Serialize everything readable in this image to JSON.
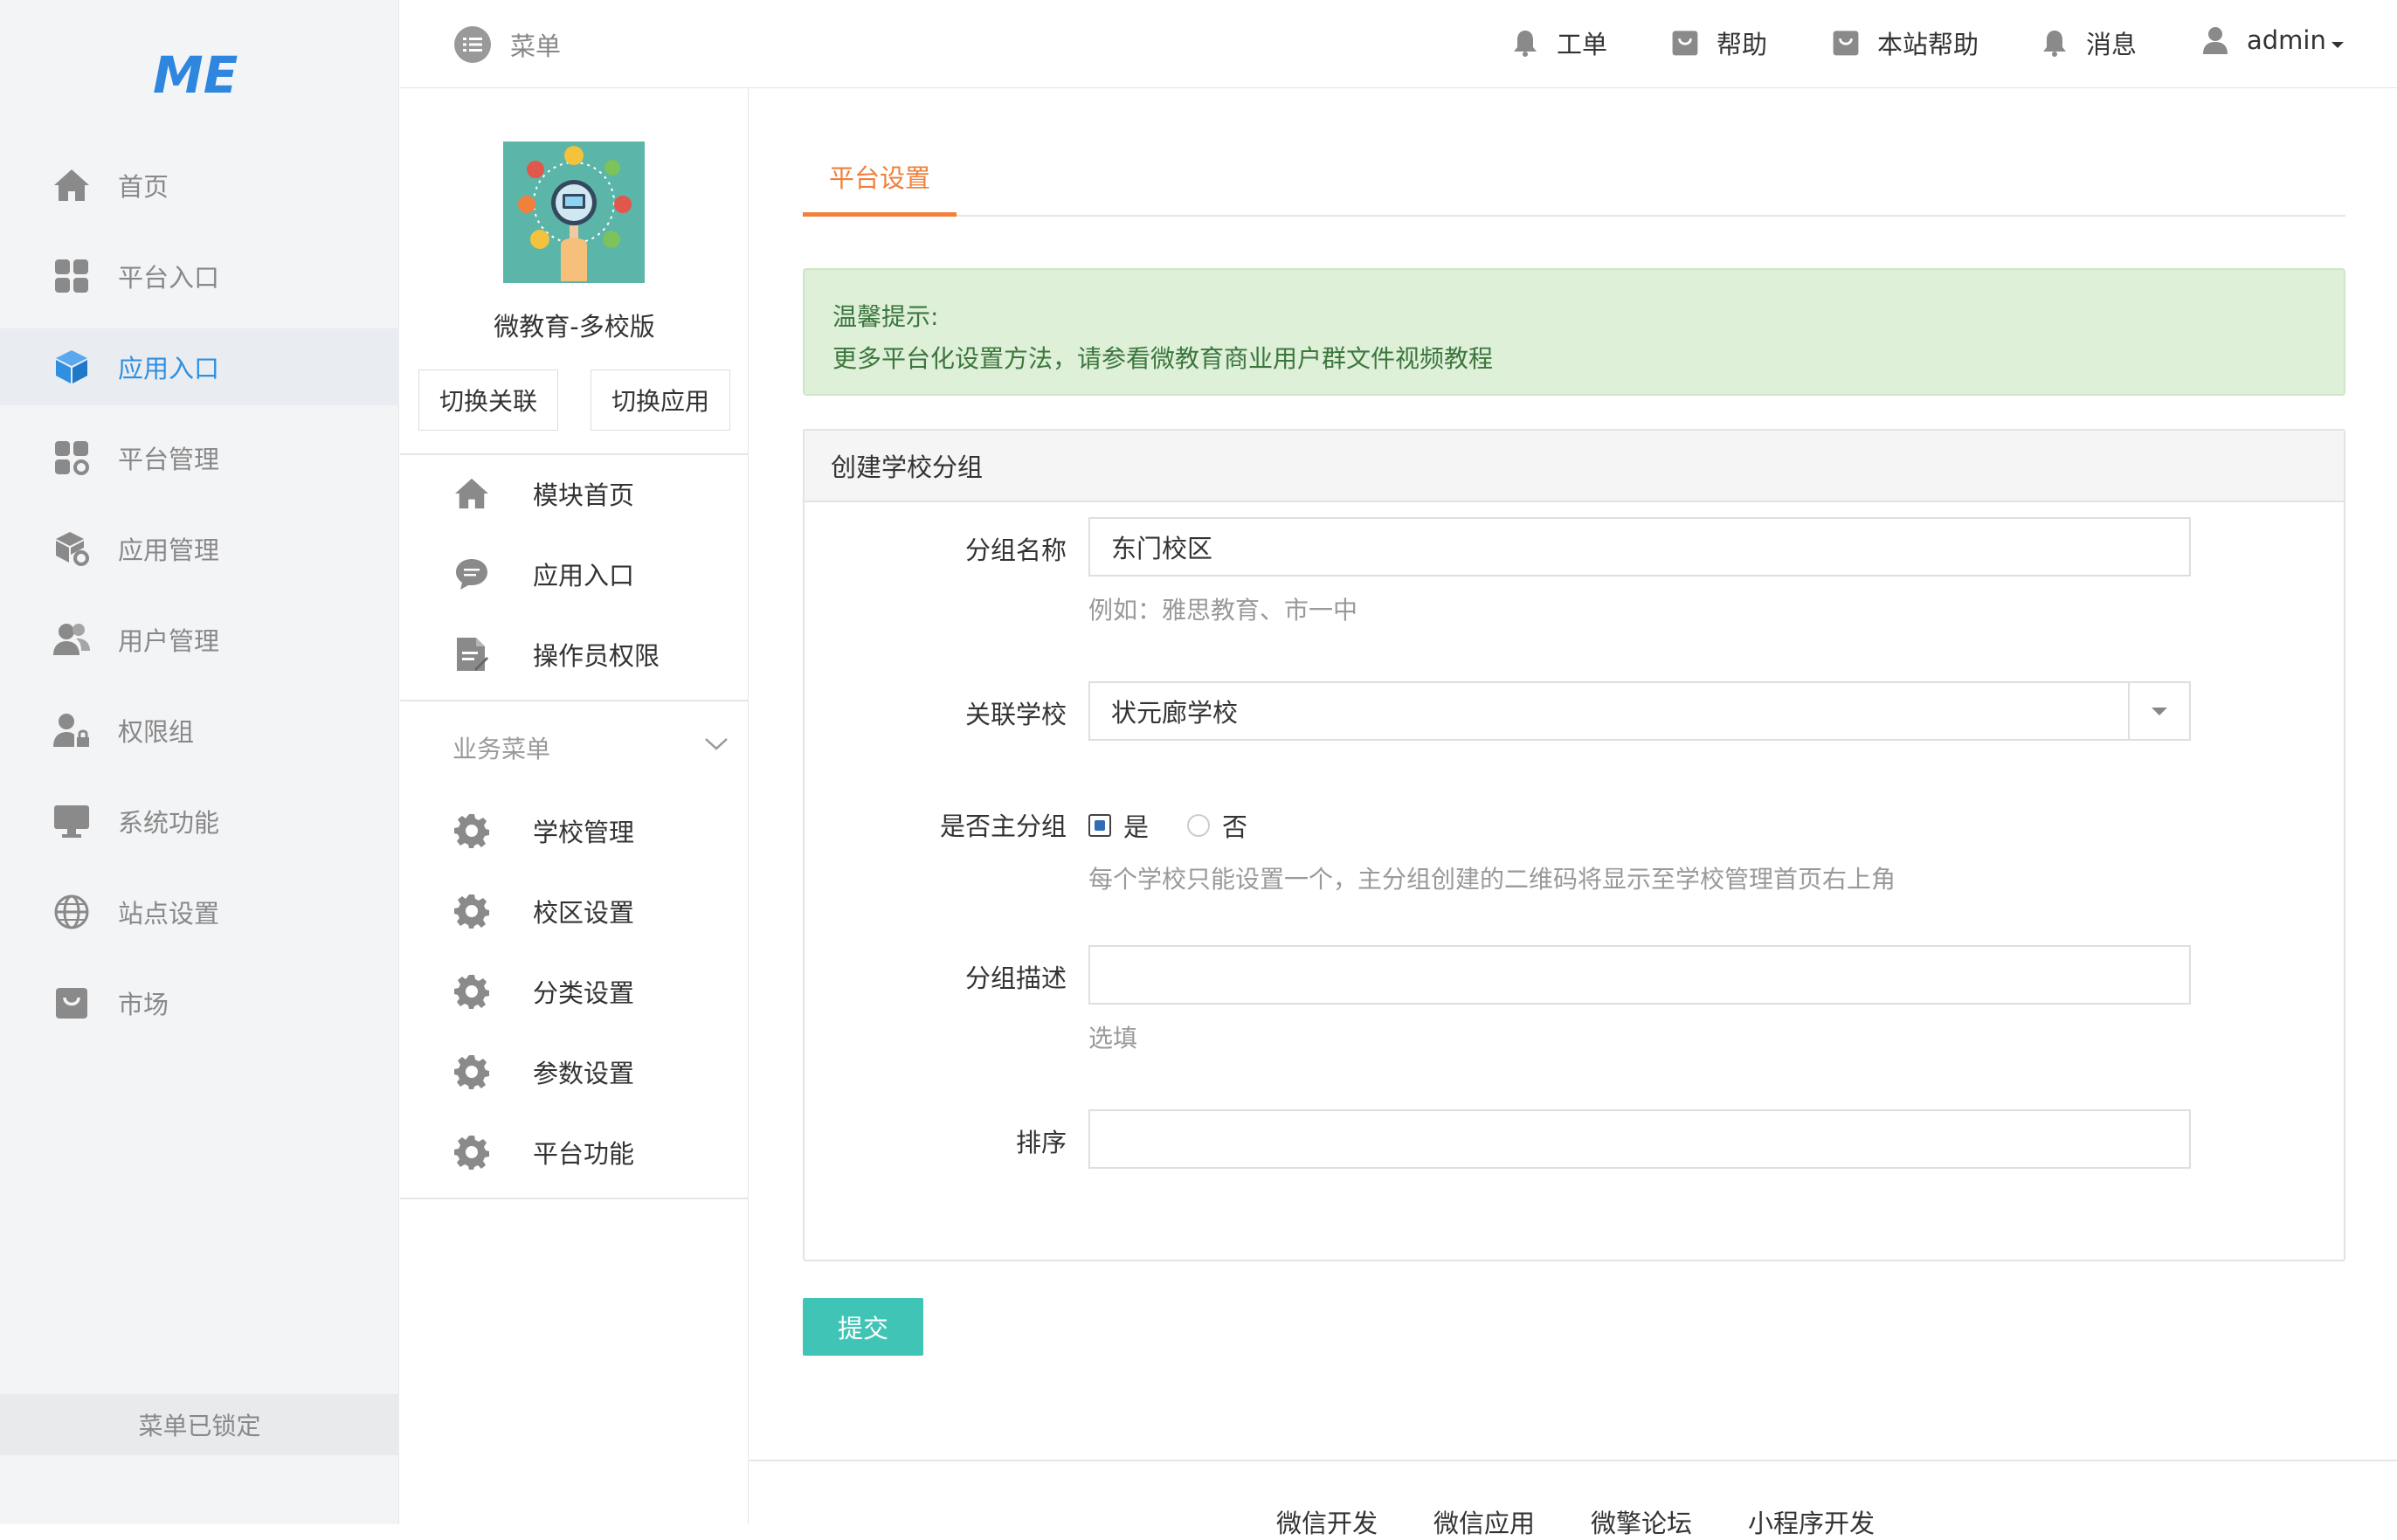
{
  "logo_text": "ME",
  "sidebar": {
    "items": [
      {
        "label": "首页",
        "icon": "home-icon"
      },
      {
        "label": "平台入口",
        "icon": "grid-icon"
      },
      {
        "label": "应用入口",
        "icon": "cube-icon",
        "active": true
      },
      {
        "label": "平台管理",
        "icon": "grid-gear-icon"
      },
      {
        "label": "应用管理",
        "icon": "cube-gear-icon"
      },
      {
        "label": "用户管理",
        "icon": "users-icon"
      },
      {
        "label": "权限组",
        "icon": "user-lock-icon"
      },
      {
        "label": "系统功能",
        "icon": "monitor-icon"
      },
      {
        "label": "站点设置",
        "icon": "globe-icon"
      },
      {
        "label": "市场",
        "icon": "bag-icon"
      }
    ],
    "locked_label": "菜单已锁定"
  },
  "topbar": {
    "menu_label": "菜单",
    "links": [
      {
        "label": "工单",
        "icon": "bell-icon"
      },
      {
        "label": "帮助",
        "icon": "bag-icon"
      },
      {
        "label": "本站帮助",
        "icon": "bag-icon"
      },
      {
        "label": "消息",
        "icon": "bell-icon"
      }
    ],
    "user": "admin"
  },
  "panel": {
    "app_name": "微教育-多校版",
    "switch_link_label": "切换关联",
    "switch_app_label": "切换应用",
    "items": [
      {
        "label": "模块首页",
        "icon": "home-icon"
      },
      {
        "label": "应用入口",
        "icon": "chat-icon"
      },
      {
        "label": "操作员权限",
        "icon": "document-icon"
      }
    ],
    "group_label": "业务菜单",
    "group_items": [
      {
        "label": "学校管理",
        "icon": "gear-icon"
      },
      {
        "label": "校区设置",
        "icon": "gear-icon"
      },
      {
        "label": "分类设置",
        "icon": "gear-icon"
      },
      {
        "label": "参数设置",
        "icon": "gear-icon"
      },
      {
        "label": "平台功能",
        "icon": "gear-icon"
      }
    ]
  },
  "main": {
    "tab_label": "平台设置",
    "alert_title": "温馨提示:",
    "alert_text": "更多平台化设置方法，请参看微教育商业用户群文件视频教程",
    "card_title": "创建学校分组",
    "fields": {
      "group_name_label": "分组名称",
      "group_name_value": "东门校区",
      "group_name_help": "例如：雅思教育、市一中",
      "school_label": "关联学校",
      "school_value": "状元廊学校",
      "is_main_label": "是否主分组",
      "yes_label": "是",
      "no_label": "否",
      "is_main_help": "每个学校只能设置一个，主分组创建的二维码将显示至学校管理首页右上角",
      "desc_label": "分组描述",
      "desc_value": "",
      "desc_help": "选填",
      "sort_label": "排序",
      "sort_value": ""
    },
    "submit_label": "提交"
  },
  "footer": {
    "links": [
      "微信开发",
      "微信应用",
      "微擎论坛",
      "小程序开发"
    ]
  },
  "colors": {
    "accent_orange": "#f0803c",
    "active_blue": "#2f8fe0",
    "submit_teal": "#40c4b6",
    "alert_green_bg": "#def0d8"
  }
}
